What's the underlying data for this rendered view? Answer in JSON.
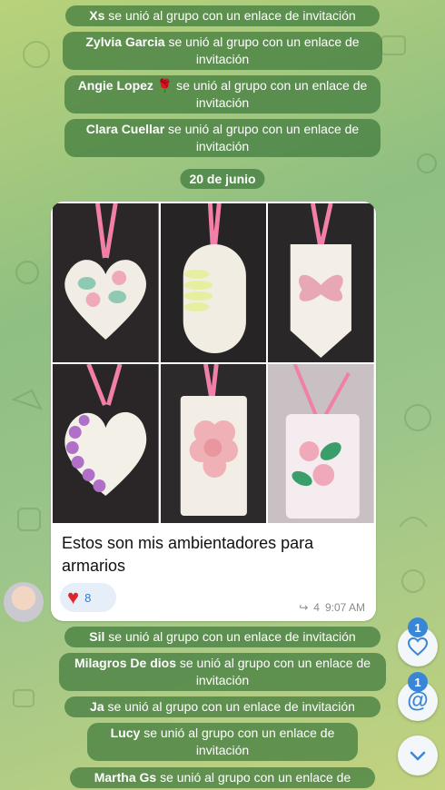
{
  "system_messages_top": [
    {
      "name": "Xs",
      "text": "se unió al grupo con un enlace de invitación"
    },
    {
      "name": "Zylvia Garcia",
      "text": "se unió al grupo con un enlace de invitación"
    },
    {
      "name": "Angie Lopez",
      "emoji": "🌹",
      "text": "se unió al grupo con un enlace de invitación"
    },
    {
      "name": "Clara Cuellar",
      "text": "se unió al grupo con un enlace de invitación"
    }
  ],
  "date_separator": "20 de junio",
  "message": {
    "caption": "Estos son mis ambientadores para armarios",
    "reaction_emoji": "♥",
    "reaction_count": "8",
    "forward_icon": "↪",
    "forwards": "4",
    "time": "9:07 AM",
    "photos": [
      "heart-leaves",
      "oval-daisy",
      "hexagon-butterfly",
      "heart-purple-flowers",
      "rect-pink-flower",
      "rect-pink-green-flowers"
    ]
  },
  "system_messages_bottom": [
    {
      "name": "Sil",
      "text": "se unió al grupo con un enlace de invitación"
    },
    {
      "name": "Milagros De dios",
      "text": "se unió al grupo con un enlace de invitación"
    },
    {
      "name": "Ja",
      "text": "se unió al grupo con un enlace de invitación"
    },
    {
      "name": "Lucy",
      "text": "se unió al grupo con un enlace de invitación"
    },
    {
      "name": "Martha Gs",
      "text": "se unió al grupo con un enlace de"
    }
  ],
  "fab": {
    "reactions_badge": "1",
    "mentions_badge": "1",
    "reactions_icon": "heart-icon",
    "mentions_icon": "at-icon",
    "scroll_icon": "chevron-down-icon"
  },
  "colors": {
    "accent": "#3a86d6",
    "bubble_system": "#3e783c",
    "heart": "#e3242b"
  }
}
